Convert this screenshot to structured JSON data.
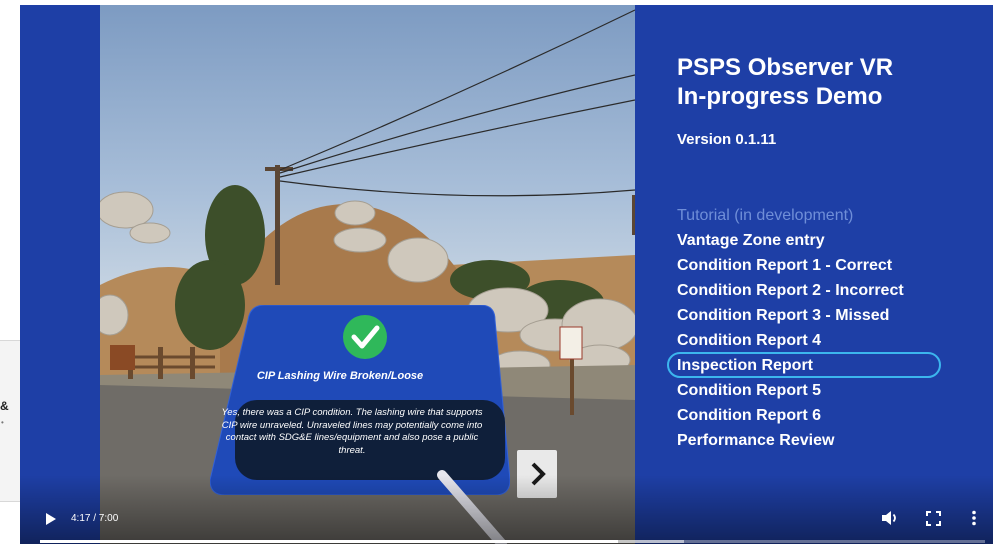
{
  "page_fragment": {
    "symbol": "&"
  },
  "video": {
    "title_line1": "PSPS Observer VR",
    "title_line2": "In-progress Demo",
    "version": "Version 0.1.11",
    "menu": [
      "Tutorial (in development)",
      "Vantage Zone entry",
      "Condition Report 1 - Correct",
      "Condition Report 2 - Incorrect",
      "Condition Report 3 - Missed",
      "Condition Report 4",
      "Inspection Report",
      "Condition Report 5",
      "Condition Report 6",
      "Performance Review"
    ],
    "highlighted_item": "Inspection Report",
    "popup": {
      "title": "CIP Lashing Wire Broken/Loose",
      "body": "Yes, there was a CIP condition. The lashing wire that supports CIP wire unraveled. Unraveled lines may potentially come into contact with SDG&E lines/equipment and also pose a public threat.",
      "next_icon": "chevron-right-icon",
      "status_icon": "check-icon"
    }
  },
  "controls": {
    "time": "4:17 / 7:00",
    "progress": 0.612,
    "icons": [
      "play-icon",
      "volume-icon",
      "fullscreen-icon",
      "more-options-icon"
    ]
  },
  "colors": {
    "background_blue": "#1e3fa6",
    "highlight": "#3cb6ee",
    "dim_text": "#6f8ed8",
    "check_green": "#2fb85a",
    "popup_blue": "#1f4ab8"
  }
}
